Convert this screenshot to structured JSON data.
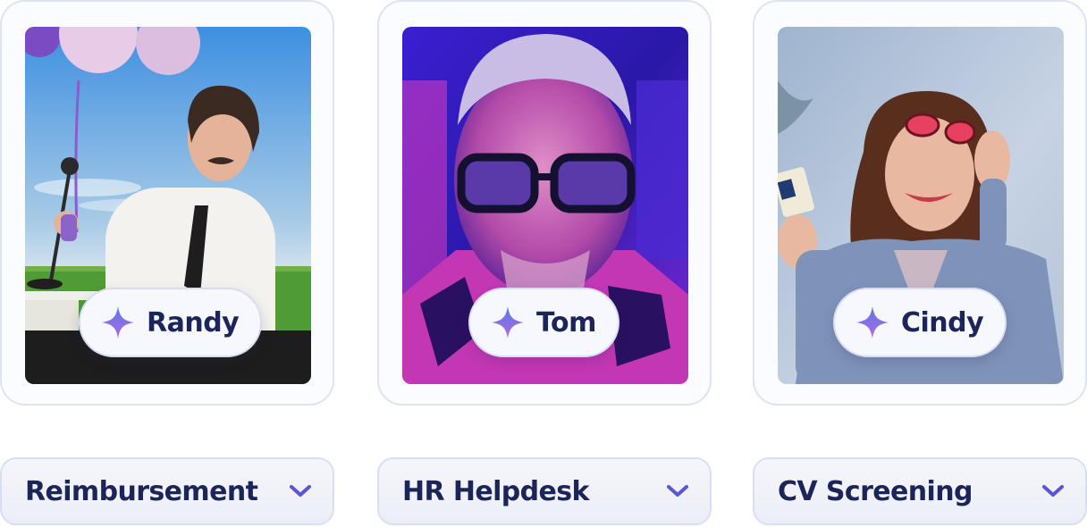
{
  "agents": [
    {
      "name": "Randy",
      "role": "Reimbursement",
      "photo_icon": "portrait-man-with-balloons"
    },
    {
      "name": "Tom",
      "role": "HR Helpdesk",
      "photo_icon": "portrait-man-with-glasses-neon"
    },
    {
      "name": "Cindy",
      "role": "CV Screening",
      "photo_icon": "portrait-woman-with-sunglasses"
    }
  ],
  "colors": {
    "text": "#1c2559",
    "card_border": "#dde3f3",
    "sparkle_top": "#5a78e8",
    "sparkle_bottom": "#b06be0",
    "chevron": "#5b55d6"
  },
  "icons": {
    "badge": "sparkle-icon",
    "dropdown": "chevron-down-icon"
  }
}
